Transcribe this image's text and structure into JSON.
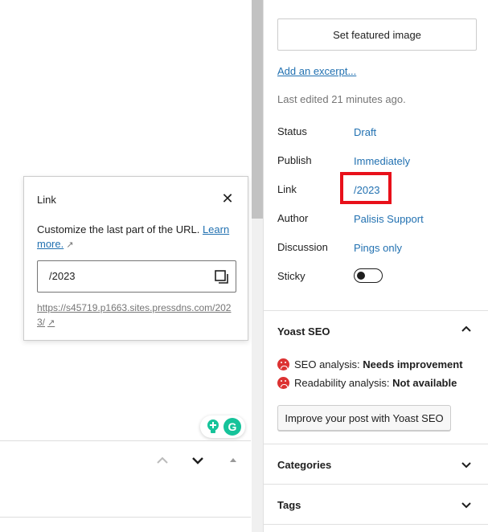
{
  "popover": {
    "title": "Link",
    "help_text": "Customize the last part of the URL.",
    "learn_more": "Learn more.",
    "slug_value": "/2023",
    "permalink": "https://s45719.p1663.sites.pressdns.com/2023/"
  },
  "sidebar": {
    "featured_image_button": "Set featured image",
    "add_excerpt": "Add an excerpt...",
    "last_edited": "Last edited 21 minutes ago.",
    "rows": [
      {
        "label": "Status",
        "value": "Draft"
      },
      {
        "label": "Publish",
        "value": "Immediately"
      },
      {
        "label": "Link",
        "value": "/2023"
      },
      {
        "label": "Author",
        "value": "Palisis Support"
      },
      {
        "label": "Discussion",
        "value": "Pings only"
      },
      {
        "label": "Sticky",
        "value": ""
      }
    ],
    "sticky_on": false
  },
  "yoast": {
    "title": "Yoast SEO",
    "seo_label": "SEO analysis:",
    "seo_value": "Needs improvement",
    "readability_label": "Readability analysis:",
    "readability_value": "Not available",
    "button": "Improve your post with Yoast SEO"
  },
  "panels": {
    "categories": "Categories",
    "tags": "Tags"
  },
  "colors": {
    "link": "#2271b1",
    "highlight": "#e8101a",
    "bad": "#dc3232",
    "grammarly": "#15c39a"
  }
}
